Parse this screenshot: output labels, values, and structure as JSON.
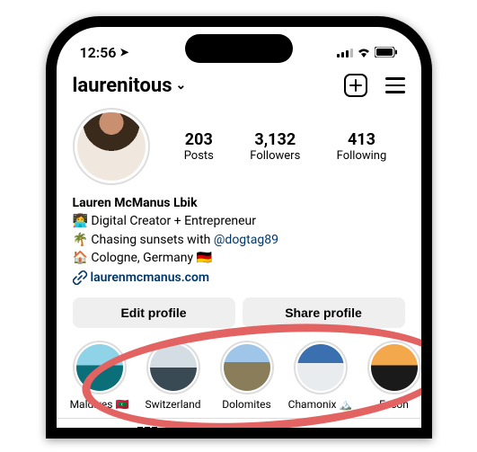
{
  "status": {
    "time": "12:56",
    "location_icon": "➤"
  },
  "header": {
    "username": "laurenitous"
  },
  "stats": {
    "posts_num": "203",
    "posts_lbl": "Posts",
    "followers_num": "3,132",
    "followers_lbl": "Followers",
    "following_num": "413",
    "following_lbl": "Following"
  },
  "bio": {
    "name": "Lauren McManus Lbik",
    "line1_emoji": "👩‍💻",
    "line1_text": "Digital Creator + Entrepreneur",
    "line2_emoji": "🌴",
    "line2_text_pre": "Chasing sunsets with ",
    "line2_link": "@dogtag89",
    "line3_emoji": "🏠",
    "line3_text": "Cologne, Germany 🇩🇪",
    "website": "laurenmcmanus.com"
  },
  "buttons": {
    "edit": "Edit profile",
    "share": "Share profile"
  },
  "highlights": [
    {
      "label": "Maldives 🇲🇻"
    },
    {
      "label": "Switzerland"
    },
    {
      "label": "Dolomites"
    },
    {
      "label": "Chamonix 🏔️"
    },
    {
      "label": "Escon"
    }
  ]
}
